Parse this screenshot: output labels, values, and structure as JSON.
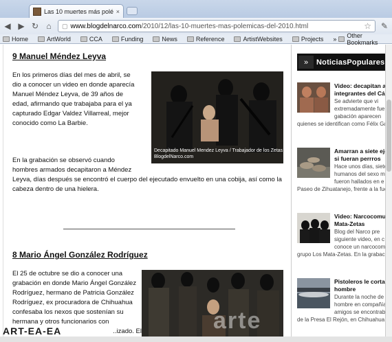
{
  "browser": {
    "tab_title": "Las 10 muertes más polémic",
    "tab_close": "×",
    "url_host": "www.blogdelnarco.com",
    "url_path": "/2010/12/las-10-muertes-mas-polemicas-del-2010.html",
    "bookmarks": [
      "Home",
      "ArtWorld",
      "CCA",
      "Funding",
      "News",
      "Reference",
      "ArtistWebsites",
      "Projects"
    ],
    "overflow": "»",
    "other_bookmarks": "Other Bookmarks"
  },
  "article": {
    "entry9": {
      "title": "9 Manuel Méndez Leyva",
      "para1": [
        "En los primeros días del mes de abril, se",
        "dio a conocer un video en donde aparecía",
        "Manuel Méndez Leyva, de 39 años de",
        "edad, afirmando que trabajaba para el ya",
        "capturado Edgar Valdez Villarreal, mejor",
        "conocido como La Barbie."
      ],
      "photo_caption1": "Decapitado Manuel Mendez Leyva / Trabajador de los Zetas",
      "photo_caption2": "BlogdelNarco.com",
      "para2": [
        "En la grabación se observó cuando",
        "hombres armados decapitaron a Méndez",
        "Leyva, días después se encontró el cuerpo del ejecutado envuelto en una cobija, así como la",
        "cabeza dentro de una hielera."
      ]
    },
    "entry8": {
      "title": "8 Mario Ángel González Rodríguez",
      "para1": [
        "El 25 de octubre se dio a conocer una",
        "grabación en donde Mario Ángel González",
        "Rodríguez, hermano de Patricia González",
        "Rodríguez, ex procuradora de Chihuahua",
        "confesaba los nexos que sostenían su",
        "hermana y otros funcionarios con",
        "..izado. El"
      ]
    }
  },
  "sidebar": {
    "title": "NoticiasPopulares",
    "posts": [
      {
        "title": [
          "Video: decapitan a d",
          "integrantes del Cárt"
        ],
        "desc": [
          "Se advierte que vi",
          "extremadamente fue",
          "gabación aparecen"
        ],
        "desc_full": "quienes se identifican como Félix Ga"
      },
      {
        "title": [
          "Amarran a siete eje",
          "si fueran perrros"
        ],
        "desc": [
          "Hace unos días, siete",
          "humanos del sexo m",
          "fueron hallados en e"
        ],
        "desc_full": "Paseo de Zihuatanejo, frente a la fue"
      },
      {
        "title": [
          "Video: Narcocomun",
          "Mata-Zetas"
        ],
        "desc": [
          "Blog del Narco pre",
          "siguiente video, en c",
          "conoce un narcocom"
        ],
        "desc_full": "grupo Los Mata-Zetas. En la grabaci"
      },
      {
        "title": [
          "Pistoleros le cortan",
          "hombre"
        ],
        "desc": [
          "Durante la noche de",
          "hombre en compañía",
          "amigos se encontrab"
        ],
        "desc_full": "de la Presa El Rejón, en Chihuahua c"
      }
    ]
  },
  "watermarks": {
    "center": "arte",
    "left": "ART-EA-EA"
  },
  "colors": {
    "sidebar_head": "#111111",
    "text": "#111111"
  }
}
